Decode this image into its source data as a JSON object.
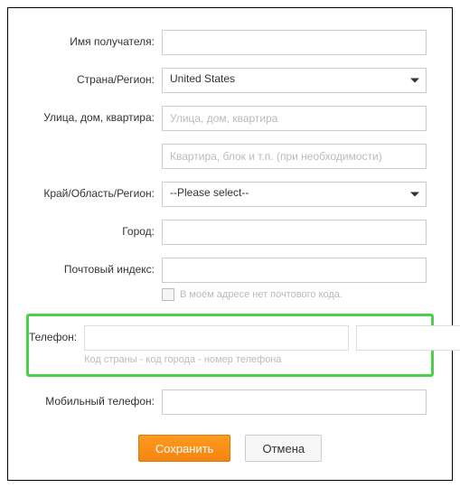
{
  "labels": {
    "recipient": "Имя получателя:",
    "country": "Страна/Регион:",
    "street": "Улица, дом, квартира:",
    "region": "Край/Область/Регион:",
    "city": "Город:",
    "zip": "Почтовый индекс:",
    "phone": "Телефон:",
    "mobile": "Мобильный телефон:"
  },
  "placeholders": {
    "street1": "Улица, дом, квартира",
    "street2": "Квартира, блок и т.п. (при необходимости)"
  },
  "country": {
    "value": "United States"
  },
  "region": {
    "value": "--Please select--"
  },
  "zip_checkbox_label": "В моём адресе нет почтового кода.",
  "phone_help": "Код страны - код города - номер телефона",
  "buttons": {
    "save": "Сохранить",
    "cancel": "Отмена"
  }
}
